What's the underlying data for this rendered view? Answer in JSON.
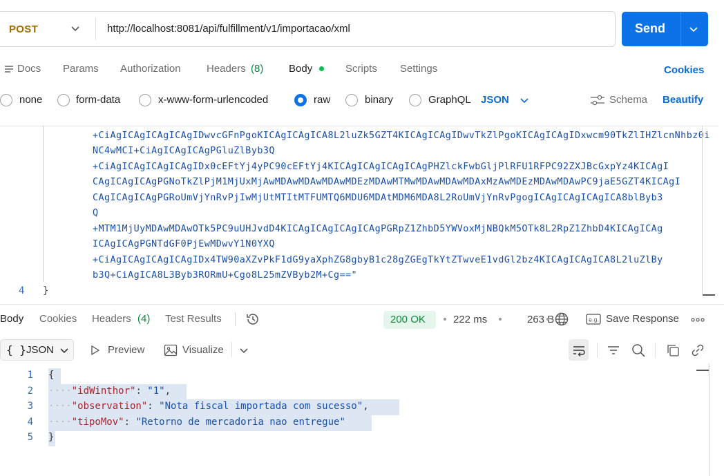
{
  "request": {
    "method": "POST",
    "url": "http://localhost:8081/api/fulfillment/v1/importacao/xml",
    "send_label": "Send"
  },
  "request_tabs": {
    "docs": "Docs",
    "params": "Params",
    "authorization": "Authorization",
    "headers": "Headers",
    "headers_count": "(8)",
    "body": "Body",
    "scripts": "Scripts",
    "settings": "Settings",
    "cookies": "Cookies"
  },
  "body_types": {
    "none": "none",
    "form_data": "form-data",
    "urlencoded": "x-www-form-urlencoded",
    "raw": "raw",
    "binary": "binary",
    "graphql": "GraphQL",
    "selected": "raw",
    "format": "JSON",
    "schema": "Schema",
    "beautify": "Beautify"
  },
  "editor": {
    "lines": [
      "+CiAgICAgICAgICAgIDwvcGFnPgoKICAgICAgICA8L2luZk5GZT4KICAgICAgIDwvTkZlPgoKICAgICAgIDxwcm90TkZlIHZlcnNhbz0i",
      "NC4wMCI+CiAgICAgICAgPGluZlByb3Q",
      "+CiAgICAgICAgICAgIDx0cEFtYj4yPC90cEFtYj4KICAgICAgICAgICAgPHZlckFwbGljPlRFU1RFPC92ZXJBcGxpYz4KICAgI",
      "CAgICAgICAgPGNoTkZlPjM1MjUxMjAwMDAwMDAwMDAwMDEzMDAwMTMwMDAwMDAwMDAxMzAwMDEzMDAwMDAwPC9jaE5GZT4KICAgI",
      "CAgICAgICAgPGRoUmVjYnRvPjIwMjUtMTItMTFUMTQ6MDU6MDAtMDM6MDA8L2RoUmVjYnRvPgogICAgICAgICAgICA8blByb3",
      "Q",
      "+MTM1MjUyMDAwMDAwOTk5PC9uUHJvdD4KICAgICAgICAgICAgPGRpZ1ZhbD5YWVoxMjNBQkM5OTk8L2RpZ1ZhbD4KICAgICAg",
      "ICAgICAgPGNTdGF0PjEwMDwvY1N0YXQ",
      "+CiAgICAgICAgICAgIDx4TW90aXZvPkF1dG9yaXphZG8gbyB1c28gZGEgTkYtZTwveE1vdGl2bz4KICAgICAgICA8L2luZlBy",
      "b3Q+CiAgICA8L3Byb3RORmU+Cgo8L25mZVByb2M+Cg==\""
    ],
    "last_line_number": "4",
    "last_line_text": "}"
  },
  "response_tabs": {
    "body": "Body",
    "cookies": "Cookies",
    "headers": "Headers",
    "headers_count": "(4)",
    "test_results": "Test Results"
  },
  "response_meta": {
    "status": "200 OK",
    "time": "222 ms",
    "size": "263 B",
    "save_response": "Save Response",
    "status_color": "#0b8a3c"
  },
  "response_toolbar": {
    "format": "JSON",
    "preview": "Preview",
    "visualize": "Visualize"
  },
  "response_body": {
    "line_numbers": [
      "1",
      "2",
      "3",
      "4",
      "5"
    ],
    "open_brace": "{",
    "close_brace": "}",
    "fields": [
      {
        "key": "\"idWinthor\"",
        "value": "\"1\"",
        "trail": ","
      },
      {
        "key": "\"observation\"",
        "value": "\"Nota fiscal importada com sucesso\"",
        "trail": ","
      },
      {
        "key": "\"tipoMov\"",
        "value": "\"Retorno de mercadoria nao entregue\"",
        "trail": ""
      }
    ]
  },
  "colors": {
    "accent": "#0b72e7",
    "method": "#a46b00",
    "json_key": "#a8242c",
    "json_string": "#1a4fa8"
  }
}
